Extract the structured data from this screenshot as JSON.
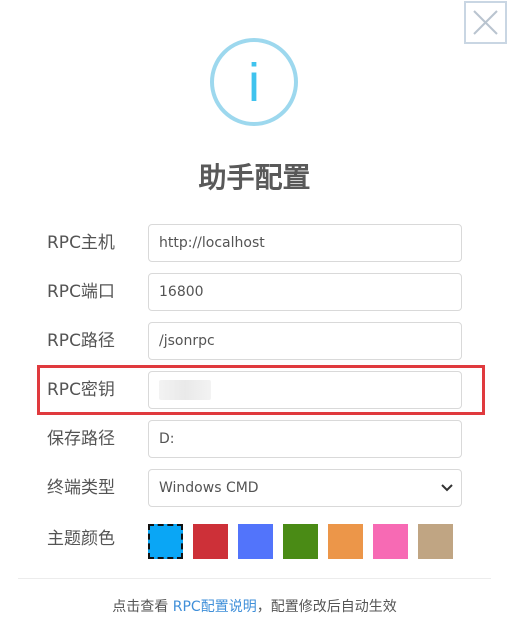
{
  "dialog": {
    "title": "助手配置",
    "info_icon_glyph": "i",
    "close_icon": "close-x-icon"
  },
  "form": {
    "rpc_host": {
      "label": "RPC主机",
      "value": "http://localhost"
    },
    "rpc_port": {
      "label": "RPC端口",
      "value": "16800"
    },
    "rpc_path": {
      "label": "RPC路径",
      "value": "/jsonrpc"
    },
    "rpc_secret": {
      "label": "RPC密钥",
      "value": ""
    },
    "save_path": {
      "label": "保存路径",
      "value": "D:"
    },
    "terminal_type": {
      "label": "终端类型",
      "selected": "Windows CMD"
    },
    "theme_color": {
      "label": "主题颜色",
      "swatches": [
        "#0aa6f5",
        "#cd3038",
        "#5274fb",
        "#4a8b15",
        "#ec9649",
        "#f76ab4",
        "#c0a583"
      ],
      "selected_index": 0
    }
  },
  "footer": {
    "prefix": "点击查看 ",
    "link": "RPC配置说明",
    "suffix": "，配置修改后自动生效"
  },
  "colors": {
    "highlight": "#e03a3e",
    "info_ring": "#9dd8ee",
    "info_glyph": "#3fc3ee",
    "link": "#3f8fd9"
  }
}
